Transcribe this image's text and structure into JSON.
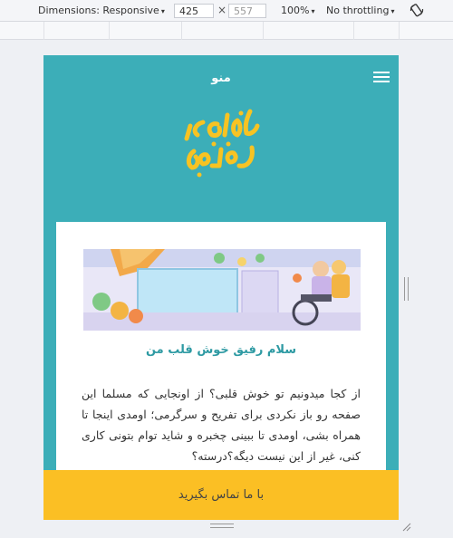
{
  "devtools": {
    "dimensions_label": "Dimensions: Responsive",
    "width_value": "425",
    "times_symbol": "×",
    "height_value": "557",
    "zoom_label": "100%",
    "throttling_label": "No throttling",
    "caret": "▾"
  },
  "page": {
    "menu_label": "منو",
    "card_title": "سلام رفیق خوش قلب من",
    "card_body": "از کجا میدونیم تو خوش قلبی؟ از اونجایی که مسلما این صفحه رو باز نکردی برای تفریح و سرگرمی؛ اومدی اینجا تا همراه بشی، اومدی تا ببینی چخبره و شاید توام بتونی کاری کنی، غیر از این نیست دیگه؟درسته؟",
    "cta_label": "با ما تماس بگیرید",
    "colors": {
      "teal": "#3caeb8",
      "yellow": "#fbbf24",
      "title_teal": "#2e9aa3"
    }
  }
}
